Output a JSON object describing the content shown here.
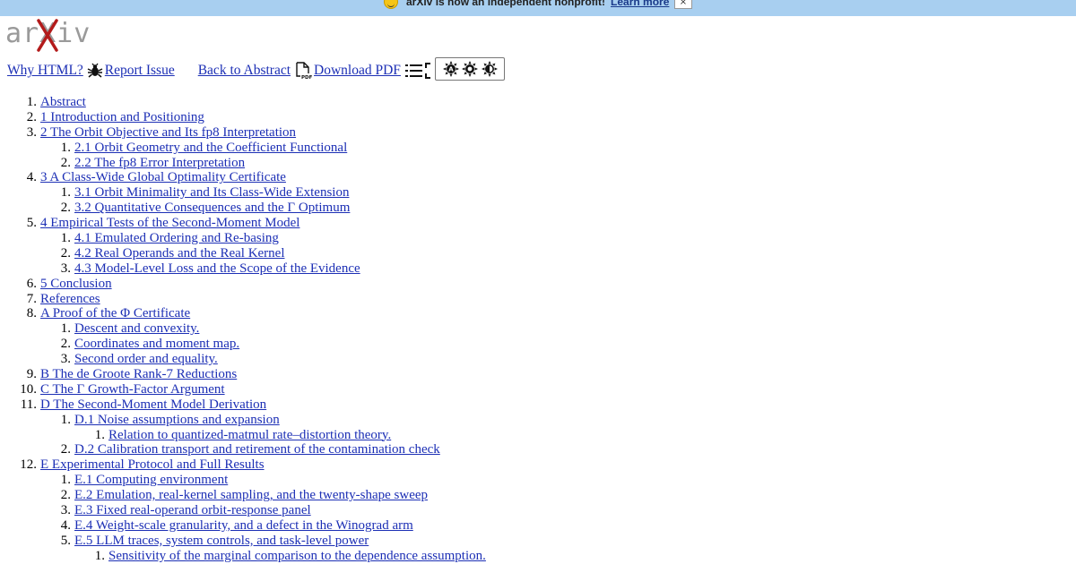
{
  "banner": {
    "text": "arXiv is now an independent nonprofit!",
    "learn_more": "Learn more",
    "close_label": "×"
  },
  "logo": {
    "text": "arXiv"
  },
  "nav": {
    "why_html": "Why HTML?",
    "report_issue": "Report Issue",
    "back_to_abstract": "Back to Abstract",
    "download_pdf": "Download PDF"
  },
  "toc": [
    {
      "num": "1.",
      "label": "Abstract",
      "level": 1
    },
    {
      "num": "2.",
      "label": "1 Introduction and Positioning",
      "level": 1
    },
    {
      "num": "3.",
      "label": "2 The Orbit Objective and Its fp8 Interpretation",
      "level": 1
    },
    {
      "num": "1.",
      "label": "2.1 Orbit Geometry and the Coefficient Functional",
      "level": 2
    },
    {
      "num": "2.",
      "label": "2.2 The fp8 Error Interpretation",
      "level": 2
    },
    {
      "num": "4.",
      "label": "3 A Class-Wide Global Optimality Certificate",
      "level": 1
    },
    {
      "num": "1.",
      "label": "3.1 Orbit Minimality and Its Class-Wide Extension",
      "level": 2
    },
    {
      "num": "2.",
      "label": "3.2 Quantitative Consequences and the Γ Optimum",
      "level": 2
    },
    {
      "num": "5.",
      "label": "4 Empirical Tests of the Second-Moment Model",
      "level": 1
    },
    {
      "num": "1.",
      "label": "4.1 Emulated Ordering and Re-basing",
      "level": 2
    },
    {
      "num": "2.",
      "label": "4.2 Real Operands and the Real Kernel",
      "level": 2
    },
    {
      "num": "3.",
      "label": "4.3 Model-Level Loss and the Scope of the Evidence",
      "level": 2
    },
    {
      "num": "6.",
      "label": "5 Conclusion",
      "level": 1
    },
    {
      "num": "7.",
      "label": "References",
      "level": 1
    },
    {
      "num": "8.",
      "label": "A Proof of the Φ Certificate",
      "level": 1
    },
    {
      "num": "1.",
      "label": "Descent and convexity.",
      "level": 2
    },
    {
      "num": "2.",
      "label": "Coordinates and moment map.",
      "level": 2
    },
    {
      "num": "3.",
      "label": "Second order and equality.",
      "level": 2
    },
    {
      "num": "9.",
      "label": "B The de Groote Rank-7 Reductions",
      "level": 1
    },
    {
      "num": "10.",
      "label": "C The Γ Growth-Factor Argument",
      "level": 1
    },
    {
      "num": "11.",
      "label": "D The Second-Moment Model Derivation",
      "level": 1
    },
    {
      "num": "1.",
      "label": "D.1 Noise assumptions and expansion",
      "level": 2
    },
    {
      "num": "1.",
      "label": "Relation to quantized-matmul rate–distortion theory.",
      "level": 3
    },
    {
      "num": "2.",
      "label": "D.2 Calibration transport and retirement of the contamination check",
      "level": 2
    },
    {
      "num": "12.",
      "label": "E Experimental Protocol and Full Results",
      "level": 1
    },
    {
      "num": "1.",
      "label": "E.1 Computing environment",
      "level": 2
    },
    {
      "num": "2.",
      "label": "E.2 Emulation, real-kernel sampling, and the twenty-shape sweep",
      "level": 2
    },
    {
      "num": "3.",
      "label": "E.3 Fixed real-operand orbit-response panel",
      "level": 2
    },
    {
      "num": "4.",
      "label": "E.4 Weight-scale granularity, and a defect in the Winograd arm",
      "level": 2
    },
    {
      "num": "5.",
      "label": "E.5 LLM traces, system controls, and task-level power",
      "level": 2
    },
    {
      "num": "1.",
      "label": "Sensitivity of the marginal comparison to the dependence assumption.",
      "level": 3
    }
  ]
}
